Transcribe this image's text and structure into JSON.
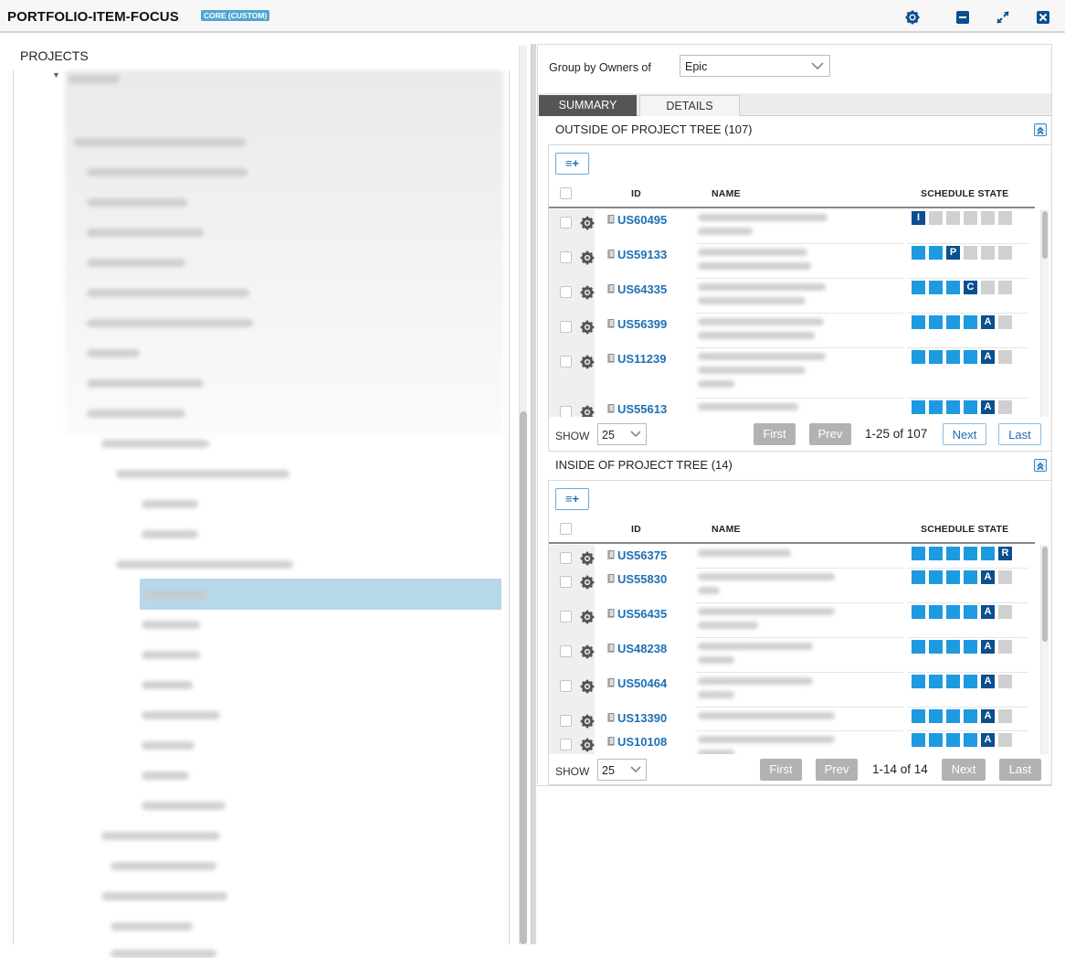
{
  "header": {
    "title": "PORTFOLIO-ITEM-FOCUS",
    "badge": "CORE (CUSTOM)",
    "buttons": [
      "gear-icon",
      "minimize-icon",
      "expand-icon",
      "close-icon"
    ]
  },
  "left": {
    "projects_label": "PROJECTS"
  },
  "right": {
    "group_label": "Group by Owners of",
    "group_value": "Epic",
    "tabs": [
      "SUMMARY",
      "DETAILS"
    ],
    "outside": {
      "title": "OUTSIDE OF PROJECT TREE (107)",
      "add_label": "≡+",
      "columns": {
        "id": "ID",
        "name": "NAME",
        "state": "SCHEDULE STATE"
      },
      "rows": [
        {
          "id": "US60495",
          "state_index": 0,
          "state_letter": "I"
        },
        {
          "id": "US59133",
          "state_index": 2,
          "state_letter": "P"
        },
        {
          "id": "US64335",
          "state_index": 3,
          "state_letter": "C"
        },
        {
          "id": "US56399",
          "state_index": 4,
          "state_letter": "A"
        },
        {
          "id": "US11239",
          "state_index": 4,
          "state_letter": "A"
        },
        {
          "id": "US55613",
          "state_index": 4,
          "state_letter": "A"
        }
      ],
      "pager": {
        "show_label": "SHOW",
        "page_size": "25",
        "first": "First",
        "prev": "Prev",
        "range": "1-25 of 107",
        "next": "Next",
        "last": "Last"
      }
    },
    "inside": {
      "title": "INSIDE OF PROJECT TREE (14)",
      "add_label": "≡+",
      "columns": {
        "id": "ID",
        "name": "NAME",
        "state": "SCHEDULE STATE"
      },
      "rows": [
        {
          "id": "US56375",
          "state_index": 5,
          "state_letter": "R"
        },
        {
          "id": "US55830",
          "state_index": 4,
          "state_letter": "A"
        },
        {
          "id": "US56435",
          "state_index": 4,
          "state_letter": "A"
        },
        {
          "id": "US48238",
          "state_index": 4,
          "state_letter": "A"
        },
        {
          "id": "US50464",
          "state_index": 4,
          "state_letter": "A"
        },
        {
          "id": "US13390",
          "state_index": 4,
          "state_letter": "A"
        },
        {
          "id": "US10108",
          "state_index": 4,
          "state_letter": "A"
        }
      ],
      "pager": {
        "show_label": "SHOW",
        "page_size": "25",
        "first": "First",
        "prev": "Prev",
        "range": "1-14 of 14",
        "next": "Next",
        "last": "Last"
      }
    }
  },
  "colors": {
    "link": "#1f6fb3",
    "state_done": "#1e9ae0",
    "state_current": "#0b4f8f",
    "state_pending": "#d0d0d0",
    "selected_tree": "#b6d8ea"
  }
}
